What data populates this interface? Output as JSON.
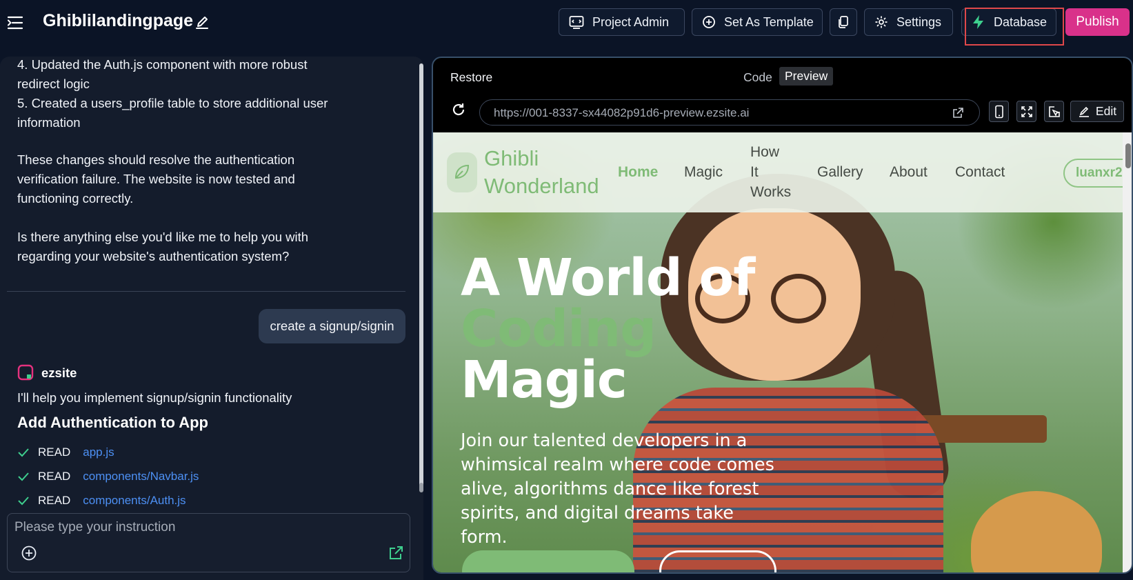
{
  "header": {
    "title": "Ghiblilandingpage",
    "buttons": {
      "project_admin": "Project Admin",
      "set_template": "Set As Template",
      "settings": "Settings",
      "database": "Database",
      "publish": "Publish"
    }
  },
  "chat": {
    "messages": [
      "4. Updated the Auth.js component with more robust\nredirect logic\n5. Created a users_profile table to store additional user\ninformation",
      "These changes should resolve the authentication\nverification failure. The website is now tested and\nfunctioning correctly.",
      "Is there anything else you'd like me to help you with\nregarding your website's authentication system?"
    ],
    "user_message": "create a signup/signin",
    "bot_name": "ezsite",
    "bot_intro": "I'll help you implement signup/signin functionality",
    "bot_heading": "Add Authentication to App",
    "reads": [
      {
        "action": "READ",
        "file": "app.js"
      },
      {
        "action": "READ",
        "file": "components/Navbar.js"
      },
      {
        "action": "READ",
        "file": "components/Auth.js"
      }
    ],
    "input_placeholder": "Please type your instruction"
  },
  "preview": {
    "restore": "Restore",
    "code_tab": "Code",
    "preview_tab": "Preview",
    "url": "https://001-8337-sx44082p91d6-preview.ezsite.ai",
    "edit": "Edit"
  },
  "site": {
    "brand": "Ghibli\nWonderland",
    "nav": [
      "Home",
      "Magic",
      "How\nIt\nWorks",
      "Gallery",
      "About",
      "Contact"
    ],
    "user": "luanxr2",
    "hero_title": [
      "A World of",
      "Coding",
      "Magic"
    ],
    "hero_sub": "Join our talented developers in a whimsical realm where code comes alive, algorithms dance like forest spirits, and digital dreams take form."
  },
  "colors": {
    "accent_pink": "#d9318a",
    "accent_green": "#7fbb76",
    "highlight_red": "#e0484a",
    "link_blue": "#4d90f4"
  }
}
